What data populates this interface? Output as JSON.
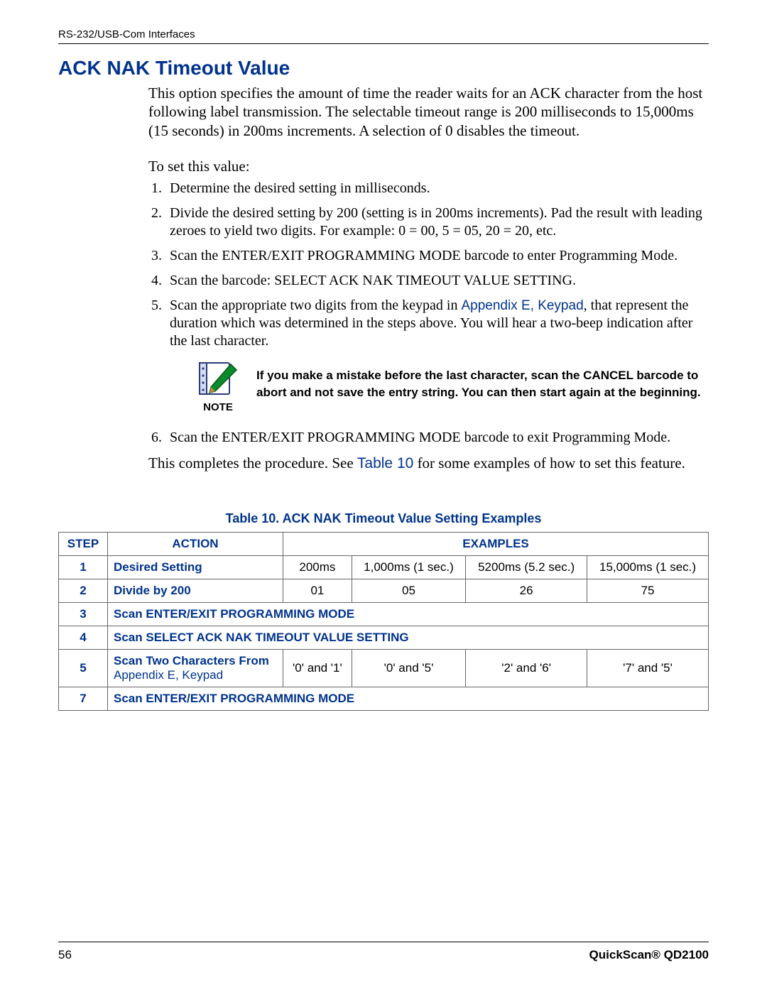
{
  "header": {
    "running": "RS-232/USB-Com Interfaces"
  },
  "title": "ACK NAK Timeout Value",
  "intro": "This option specifies the amount of time the reader waits for an ACK character from the host following label transmission. The selectable timeout range is 200 milliseconds to 15,000ms (15 seconds) in 200ms increments. A selection of 0 disables the timeout.",
  "lead": "To set this value:",
  "steps": {
    "s1": "Determine the desired setting in milliseconds.",
    "s2": "Divide the desired setting by 200 (setting is in 200ms increments).  Pad the result with leading zeroes to yield two digits. For example: 0 = 00, 5 = 05, 20 = 20, etc.",
    "s3": "Scan the ENTER/EXIT PROGRAMMING MODE barcode to enter Programming Mode.",
    "s4": "Scan the barcode: SELECT ACK NAK TIMEOUT VALUE SETTING.",
    "s5a": "Scan the appropriate two digits from the keypad in ",
    "s5_link": "Appendix E, Keypad",
    "s5b": ", that represent the duration which was determined in the steps above. You will hear a two-beep indication after the last character.",
    "s6": "Scan the ENTER/EXIT PROGRAMMING MODE barcode to exit Programming Mode."
  },
  "note": {
    "label": "NOTE",
    "text": "If you make a mistake before the last character, scan the CANCEL barcode to abort and not save the entry string. You can then start again at the beginning."
  },
  "closing_a": "This completes the procedure. See ",
  "closing_link": "Table 10",
  "closing_b": " for some examples of how to set this feature.",
  "table": {
    "title": "Table 10. ACK NAK Timeout Value Setting Examples",
    "head_step": "STEP",
    "head_action": "ACTION",
    "head_examples": "EXAMPLES",
    "rows": {
      "r1": {
        "step": "1",
        "action": "Desired Setting",
        "c1": "200ms",
        "c2": "1,000ms (1 sec.)",
        "c3": "5200ms (5.2 sec.)",
        "c4": "15,000ms (1 sec.)"
      },
      "r2": {
        "step": "2",
        "action": "Divide by 200",
        "c1": "01",
        "c2": "05",
        "c3": "26",
        "c4": "75"
      },
      "r3": {
        "step": "3",
        "action": "Scan ENTER/EXIT PROGRAMMING MODE"
      },
      "r4": {
        "step": "4",
        "action": "Scan SELECT ACK NAK TIMEOUT VALUE SETTING"
      },
      "r5": {
        "step": "5",
        "action_a": "Scan Two Characters From ",
        "action_link": "Appendix E, Keypad",
        "c1": "'0' and '1'",
        "c2": "'0' and '5'",
        "c3": "'2' and '6'",
        "c4": "'7' and '5'"
      },
      "r7": {
        "step": "7",
        "action": "Scan ENTER/EXIT PROGRAMMING MODE"
      }
    }
  },
  "footer": {
    "page": "56",
    "doc": "QuickScan® QD2100"
  }
}
